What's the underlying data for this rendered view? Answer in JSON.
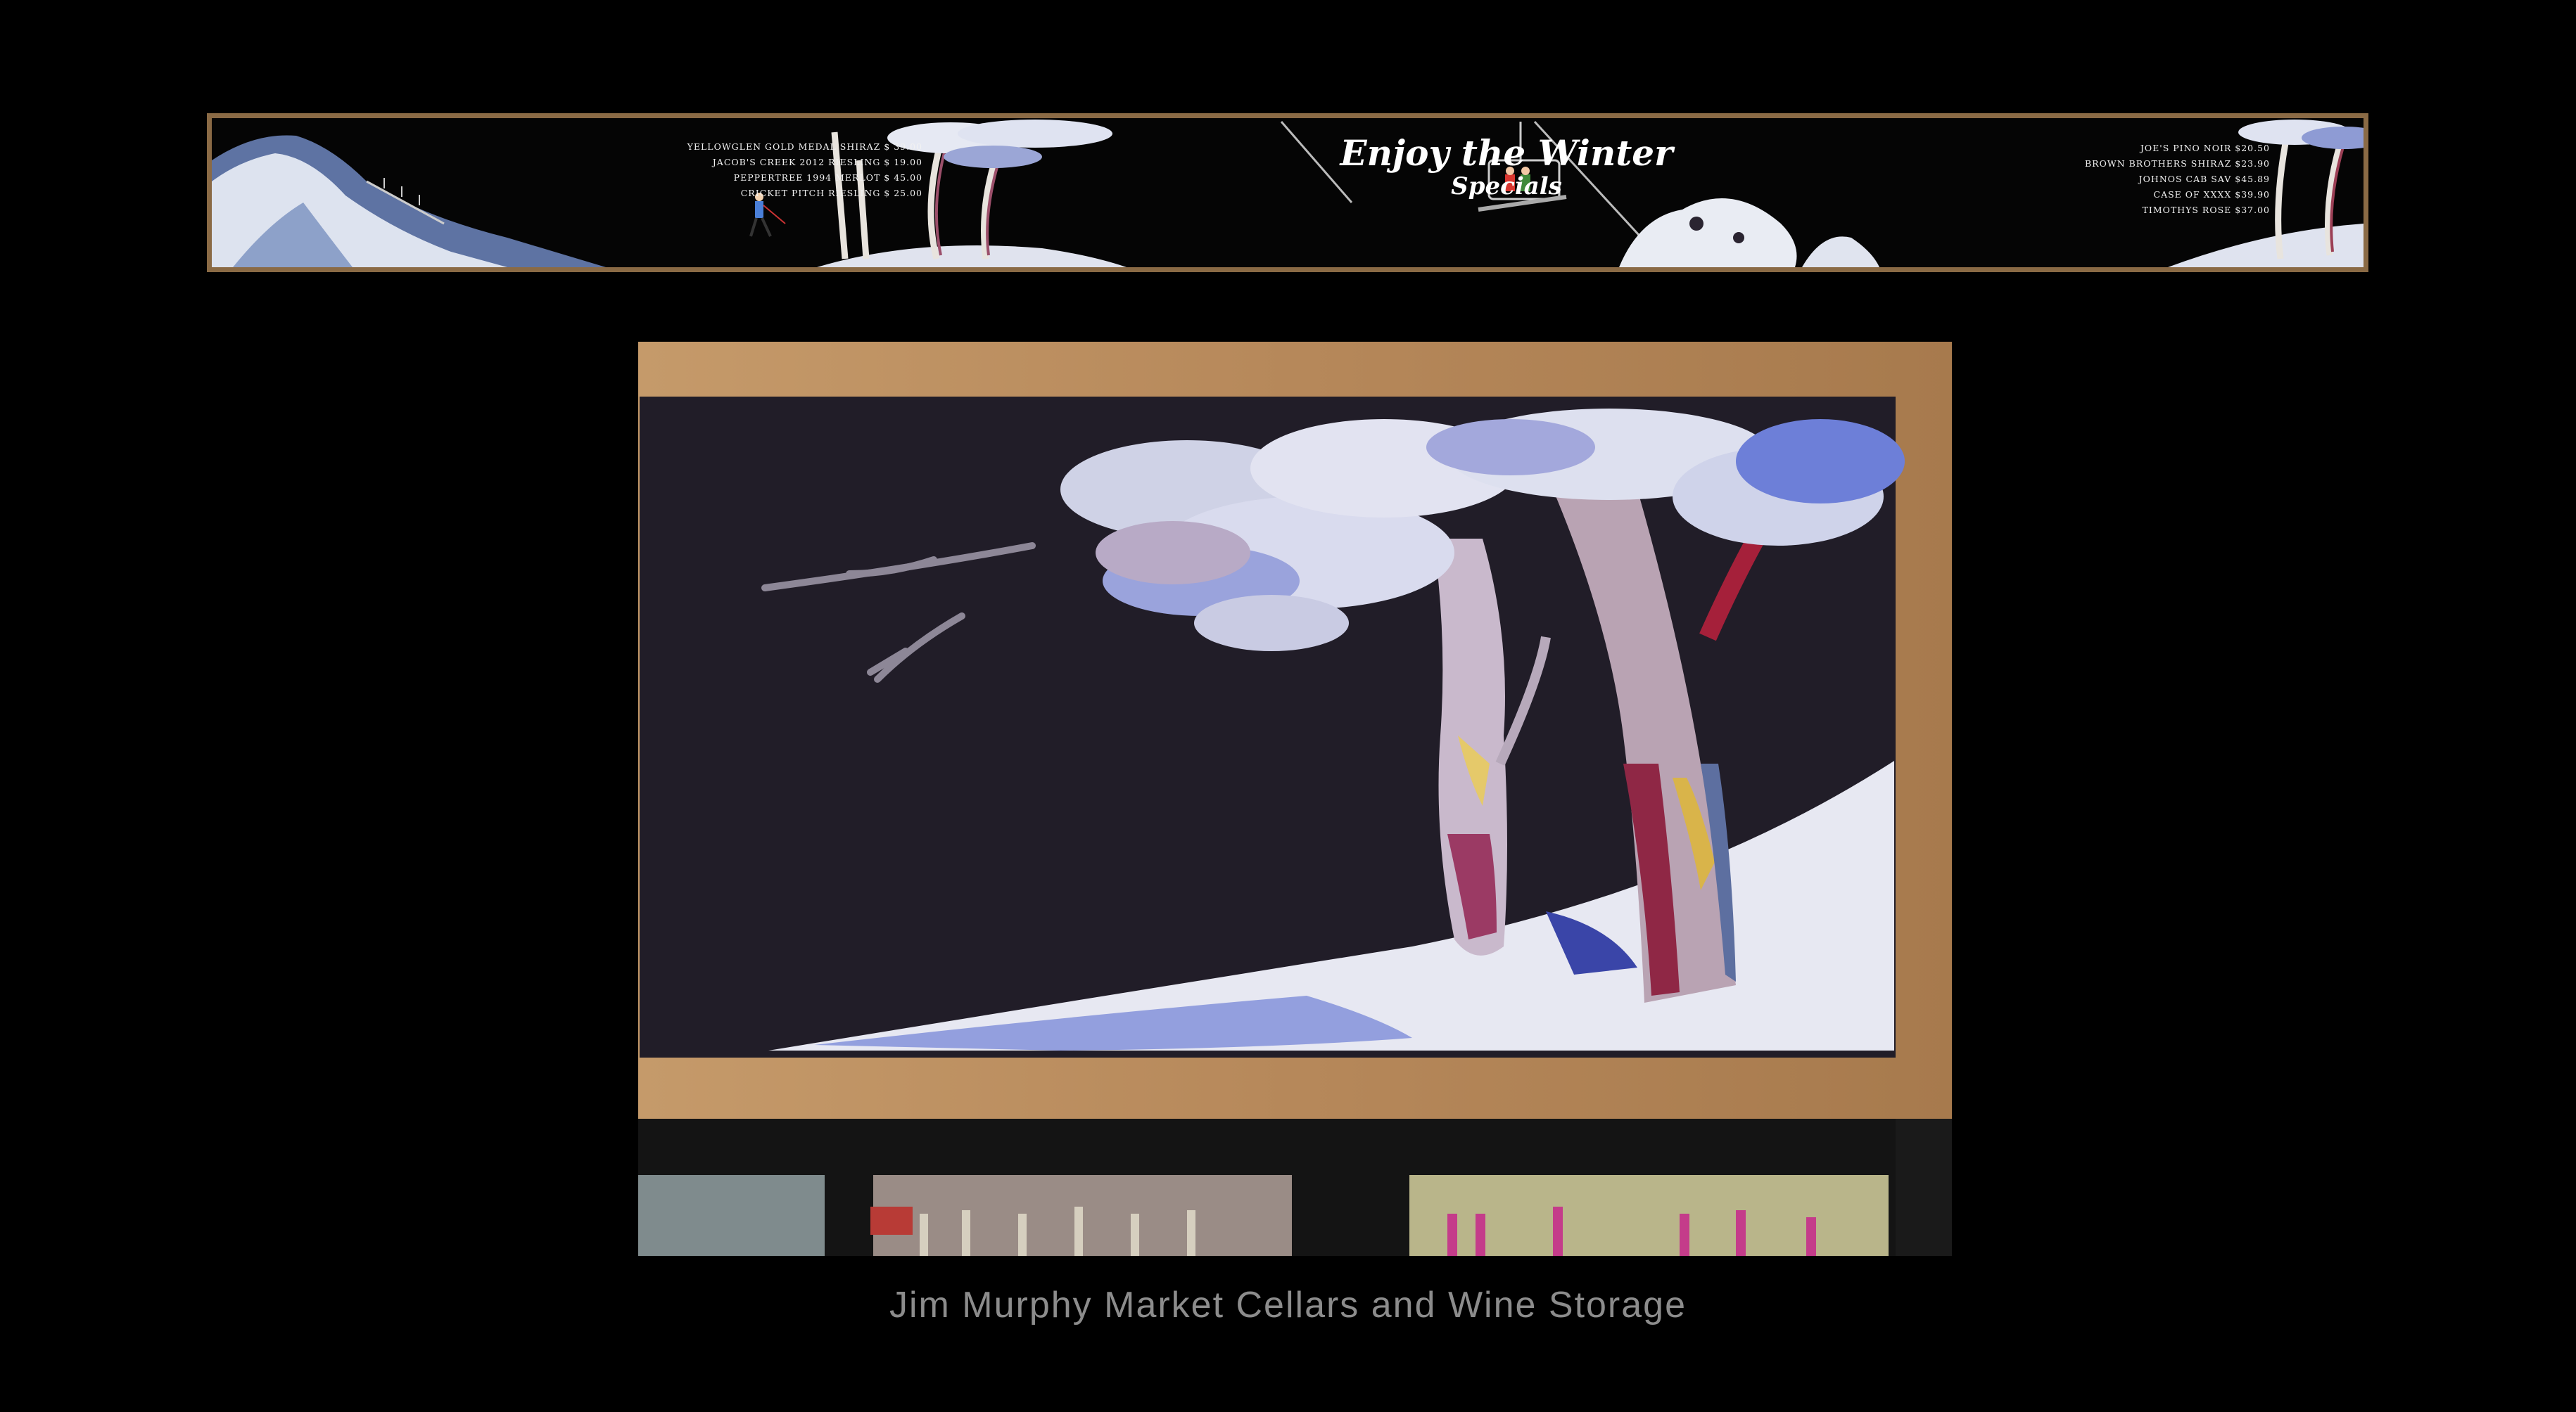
{
  "banner": {
    "title": "Enjoy the Winter",
    "subtitle": "Specials",
    "menu_left": [
      "Yellowglen Gold Medal Shiraz $ 39.00",
      "Jacob's Creek 2012 Riesling $ 19.00",
      "Peppertree 1994 Merlot $ 45.00",
      "Cricket Pitch Riesling $ 25.00"
    ],
    "menu_right": [
      "Joe's Pino Noir $20.50",
      "Brown Brothers Shiraz $23.90",
      "Johnos Cab Sav $45.89",
      "Case of XXXX $39.90",
      "Timothys Rose $37.00"
    ]
  },
  "caption": "Jim Murphy Market Cellars and Wine Storage",
  "colors": {
    "background": "#000000",
    "frame_wood": "#b68a5c",
    "chalkboard": "#201c27",
    "snow": "#e6e6f2",
    "caption_text": "#8c8c8c"
  }
}
